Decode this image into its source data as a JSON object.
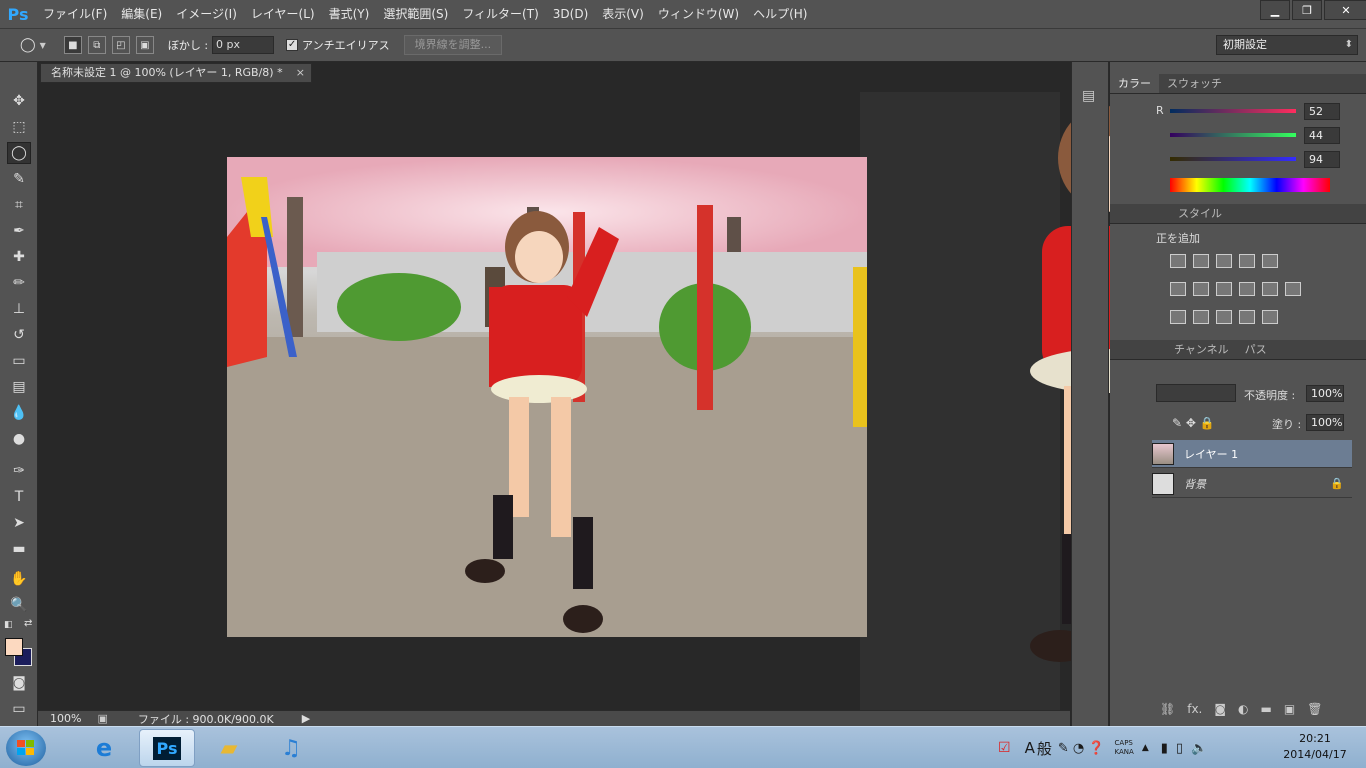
{
  "app": {
    "logo": "Ps",
    "menu": [
      "ファイル(F)",
      "編集(E)",
      "イメージ(I)",
      "レイヤー(L)",
      "書式(Y)",
      "選択範囲(S)",
      "フィルター(T)",
      "3D(D)",
      "表示(V)",
      "ウィンドウ(W)",
      "ヘルプ(H)"
    ],
    "window_controls": {
      "minimize": "▁",
      "restore": "❐",
      "close": "✕"
    }
  },
  "options": {
    "feather_label": "ぼかし :",
    "feather_value": "0 px",
    "antialias_label": "アンチエイリアス",
    "antialias_checked": "✓",
    "refine_edge": "境界線を調整...",
    "workspace": "初期設定"
  },
  "document": {
    "tab_title": "名称未設定 1 @ 100% (レイヤー 1, RGB/8) *",
    "tab_close": "×",
    "zoom": "100%",
    "file_info": "ファイル : 900.0K/900.0K"
  },
  "color_panel": {
    "tabs": [
      "カラー",
      "スウォッチ"
    ],
    "r_label": "R",
    "r": "52",
    "g": "44",
    "b": "94"
  },
  "adjust_panel": {
    "tabs": [
      "スタイル"
    ],
    "title": "正を追加"
  },
  "layers_panel": {
    "tabs": [
      "チャンネル",
      "パス"
    ],
    "opacity_label": "不透明度 :",
    "opacity": "100%",
    "fill_label": "塗り :",
    "fill": "100%",
    "layers": [
      {
        "name": "レイヤー 1"
      },
      {
        "name": "背景"
      }
    ],
    "footer_fx": "fx."
  },
  "taskbar": {
    "ps_label": "Ps",
    "ime_a": "A",
    "ime_mode": "般",
    "caps": "CAPS",
    "kana": "KANA",
    "time": "20:21",
    "date": "2014/04/17"
  }
}
